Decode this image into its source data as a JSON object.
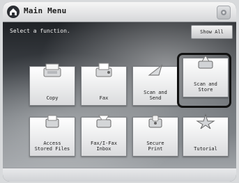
{
  "header": {
    "title": "Main Menu",
    "home_icon": "home-icon",
    "right_icon": "settings-icon"
  },
  "main": {
    "prompt": "Select a function.",
    "show_all_label": "Show All",
    "selected_tile": "Scan and Store",
    "tiles": [
      {
        "label": "Copy",
        "icon": "copy-icon"
      },
      {
        "label": "Fax",
        "icon": "fax-icon"
      },
      {
        "label": "Scan and\nSend",
        "icon": "scan-send-icon"
      },
      {
        "label": "Scan and\nStore",
        "icon": "scan-store-icon"
      },
      {
        "label": "Access\nStored Files",
        "icon": "stored-files-icon"
      },
      {
        "label": "Fax/I-Fax\nInbox",
        "icon": "fax-inbox-icon"
      },
      {
        "label": "Secure\nPrint",
        "icon": "secure-print-icon"
      },
      {
        "label": "Tutorial",
        "icon": "tutorial-icon"
      }
    ]
  },
  "colors": {
    "accent": "#111111",
    "background_dark": "#1f2226",
    "tile_bg": "#ffffff"
  }
}
